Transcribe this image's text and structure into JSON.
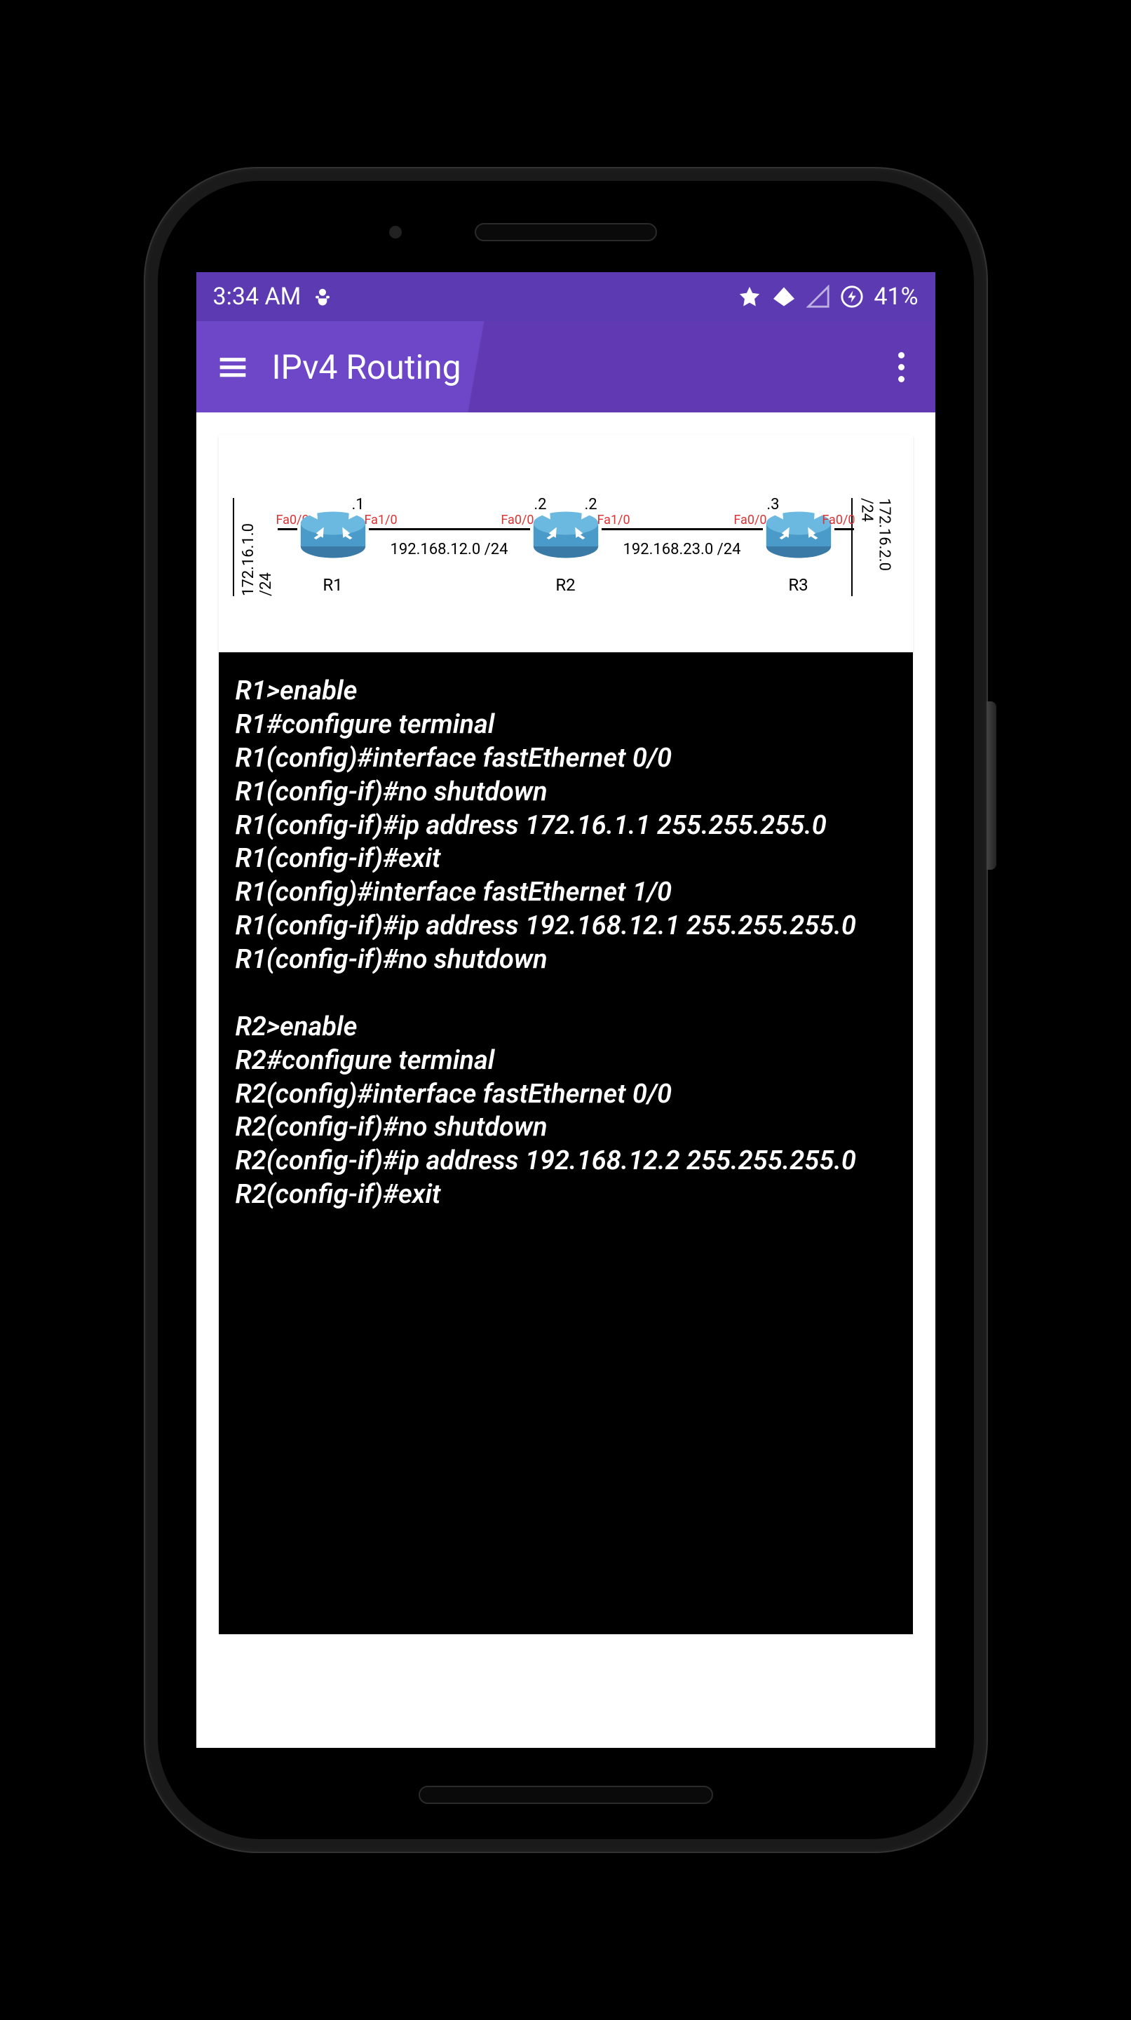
{
  "status_bar": {
    "time": "3:34 AM",
    "battery_percent": "41%"
  },
  "app_bar": {
    "title": "IPv4 Routing"
  },
  "diagram": {
    "left_network": "172.16.1.0 /24",
    "right_network": "172.16.2.0 /24",
    "routers": [
      {
        "name": "R1",
        "left_if": "Fa0/0",
        "right_if": "Fa1/0",
        "right_octet": ".1"
      },
      {
        "name": "R2",
        "left_if": "Fa0/0",
        "right_if": "Fa1/0",
        "left_octet": ".2",
        "right_octet": ".2"
      },
      {
        "name": "R3",
        "left_if": "Fa0/0",
        "right_if": "Fa0/0",
        "left_octet": ".3"
      }
    ],
    "link_subnets": [
      "192.168.12.0 /24",
      "192.168.23.0 /24"
    ]
  },
  "terminal_lines": [
    "R1>enable",
    "R1#configure terminal",
    "R1(config)#interface fastEthernet 0/0",
    "R1(config-if)#no shutdown",
    "R1(config-if)#ip address 172.16.1.1 255.255.255.0",
    "R1(config-if)#exit",
    "R1(config)#interface fastEthernet 1/0",
    "R1(config-if)#ip address 192.168.12.1 255.255.255.0",
    "R1(config-if)#no shutdown",
    "",
    "R2>enable",
    "R2#configure terminal",
    "R2(config)#interface fastEthernet 0/0",
    "R2(config-if)#no shutdown",
    "R2(config-if)#ip address 192.168.12.2 255.255.255.0",
    "R2(config-if)#exit"
  ]
}
